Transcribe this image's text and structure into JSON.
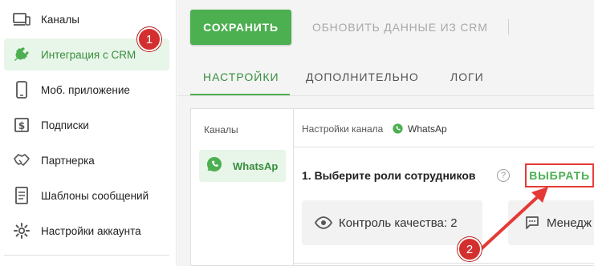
{
  "sidebar": {
    "items": [
      {
        "label": "Каналы",
        "icon": "devices-icon"
      },
      {
        "label": "Интеграция с CRM",
        "icon": "plug-icon",
        "active": true
      },
      {
        "label": "Моб. приложение",
        "icon": "phone-icon"
      },
      {
        "label": "Подписки",
        "icon": "dollar-icon"
      },
      {
        "label": "Партнерка",
        "icon": "handshake-icon"
      },
      {
        "label": "Шаблоны сообщений",
        "icon": "document-icon"
      },
      {
        "label": "Настройки аккаунта",
        "icon": "gear-icon"
      }
    ]
  },
  "toolbar": {
    "save_label": "СОХРАНИТЬ",
    "refresh_label": "ОБНОВИТЬ ДАННЫЕ ИЗ CRM"
  },
  "tabs": [
    {
      "label": "НАСТРОЙКИ",
      "active": true
    },
    {
      "label": "ДОПОЛНИТЕЛЬНО"
    },
    {
      "label": "ЛОГИ"
    }
  ],
  "channels": {
    "title": "Каналы",
    "items": [
      {
        "name": "WhatsAp"
      }
    ]
  },
  "settings": {
    "header_label": "Настройки канала",
    "channel_name": "WhatsAp",
    "step_title": "1. Выберите роли сотрудников",
    "help_glyph": "?",
    "choose_label": "ВЫБРАТЬ",
    "roles": [
      {
        "label": "Контроль качества: 2",
        "icon": "eye-icon"
      },
      {
        "label": "Менедж",
        "icon": "chat-icon"
      }
    ]
  },
  "annotations": {
    "badge1": "1",
    "badge2": "2"
  },
  "colors": {
    "accent": "#4caf50",
    "accent_dark": "#388e3c",
    "annotation_red": "#e53935"
  }
}
